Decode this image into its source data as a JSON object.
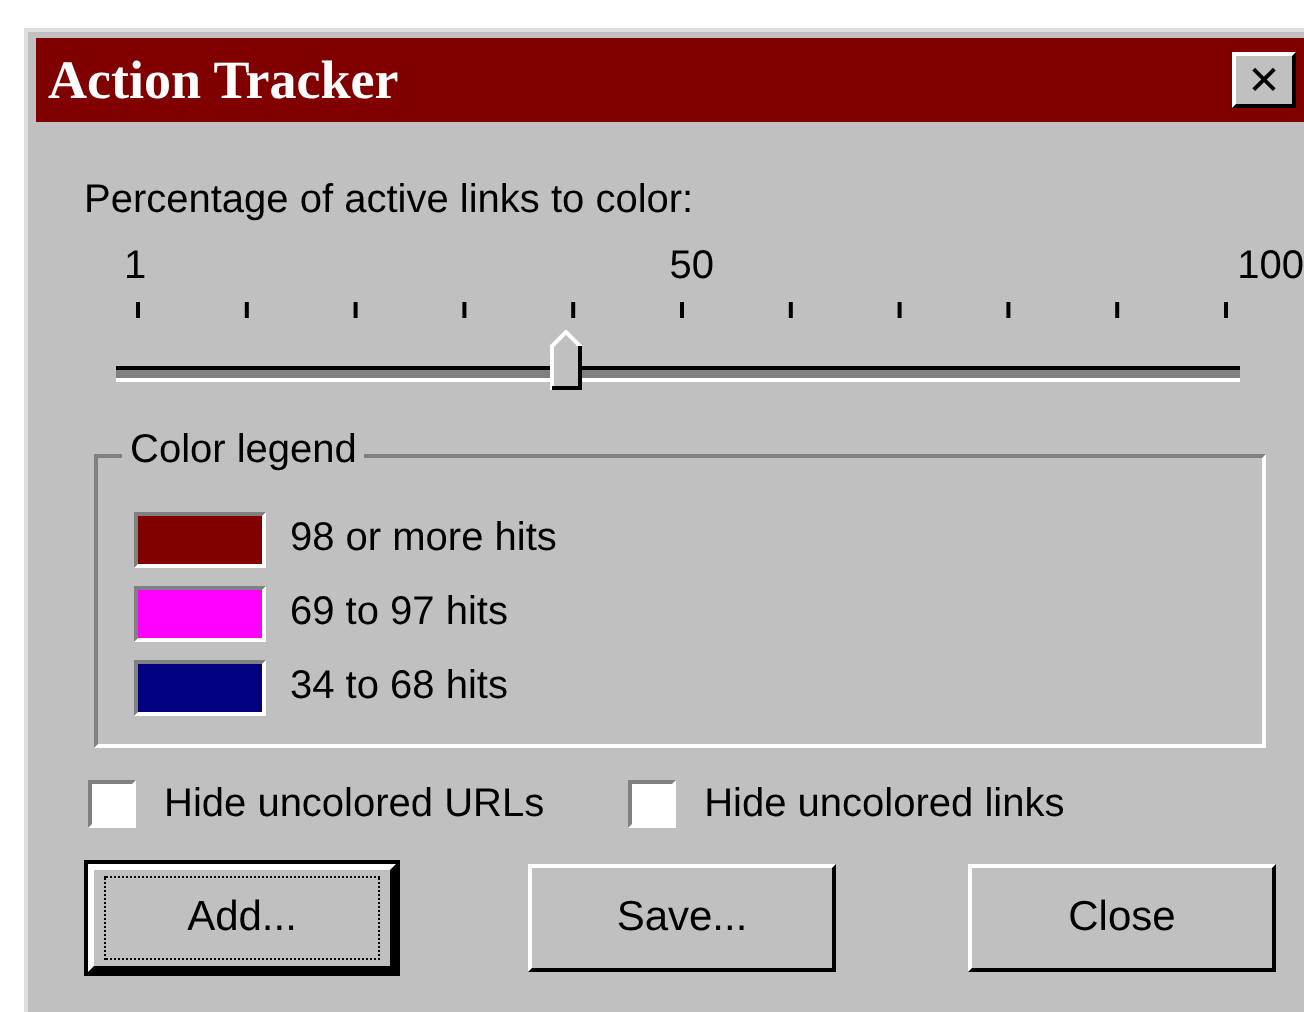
{
  "window": {
    "title": "Action Tracker",
    "close": "✕"
  },
  "slider": {
    "label": "Percentage of active links to color:",
    "ticks": [
      "1",
      "50",
      "100"
    ],
    "level": 0.4
  },
  "legend": {
    "title": "Color legend",
    "items": [
      {
        "label": "98 or more hits",
        "color": "#800000"
      },
      {
        "label": "69 to 97 hits",
        "color": "#ff00ff"
      },
      {
        "label": "34 to 68 hits",
        "color": "#000080"
      }
    ]
  },
  "checkboxes": [
    {
      "label": "Hide uncolored URLs",
      "checked": false
    },
    {
      "label": "Hide uncolored links",
      "checked": false
    }
  ],
  "buttons": [
    {
      "label": "Add...",
      "default": true
    },
    {
      "label": "Save...",
      "default": false
    },
    {
      "label": "Close",
      "default": false
    }
  ]
}
